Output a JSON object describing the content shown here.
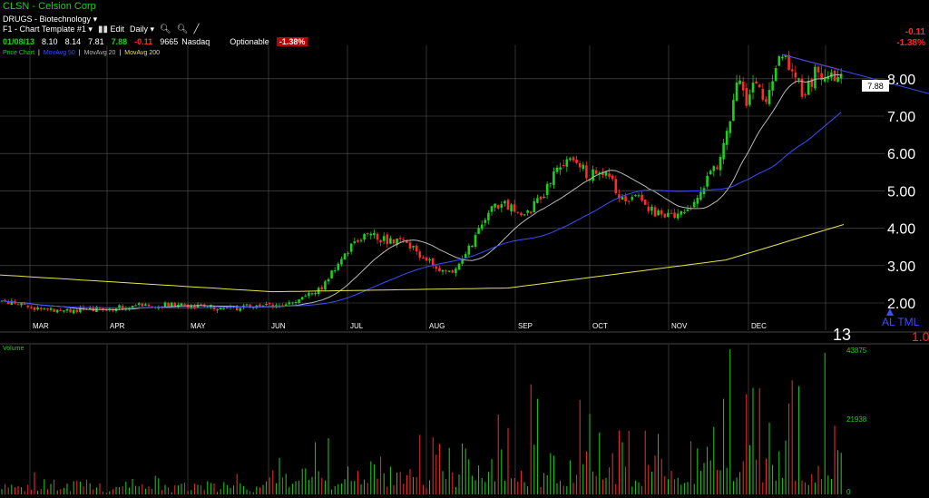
{
  "header": {
    "symbol": "CLSN",
    "separator": "-",
    "company": "Celsion Corp",
    "industry": "DRUGS - Biotechnology",
    "template": "F1 - Chart Template #1",
    "edit_label": "Edit",
    "period": "Daily"
  },
  "quote": {
    "date": "01/08/13",
    "open": "8.10",
    "high": "8.14",
    "low": "7.81",
    "last": "7.88",
    "change": "-0.11",
    "volume": "9665",
    "exchange": "Nasdaq",
    "optionable": "Optionable",
    "pct_change": "-1.38%"
  },
  "indicators": {
    "price_chart": "Price Chart",
    "mov_avg_50": "MovAvg 50",
    "mov_avg_20": "MovAvg 20",
    "mov_avg_200": "MovAvg 200"
  },
  "top_right": {
    "change": "-0.11",
    "pct": "-1.38%"
  },
  "price_axis": {
    "ticks": [
      "8.00",
      "7.00",
      "6.00",
      "5.00",
      "4.00",
      "3.00",
      "2.00"
    ],
    "last_price_tag": "7.88"
  },
  "months": [
    "MAR",
    "APR",
    "MAY",
    "JUN",
    "JUL",
    "AUG",
    "SEP",
    "OCT",
    "NOV",
    "DEC"
  ],
  "year_marker": "13",
  "corner": {
    "label": "AL TML",
    "value": "1.0"
  },
  "volume_panel": {
    "title": "Volume",
    "ticks": [
      "43875",
      "21938",
      "0"
    ]
  },
  "colors": {
    "up": "#19d219",
    "down": "#ff2a2a",
    "ma20": "#b9b9b9",
    "ma50": "#3d4dff",
    "ma200": "#e8e44a",
    "grid": "#555555",
    "trendline_red": "#ff2a2a",
    "trendline_blue": "#3d4dff"
  }
}
